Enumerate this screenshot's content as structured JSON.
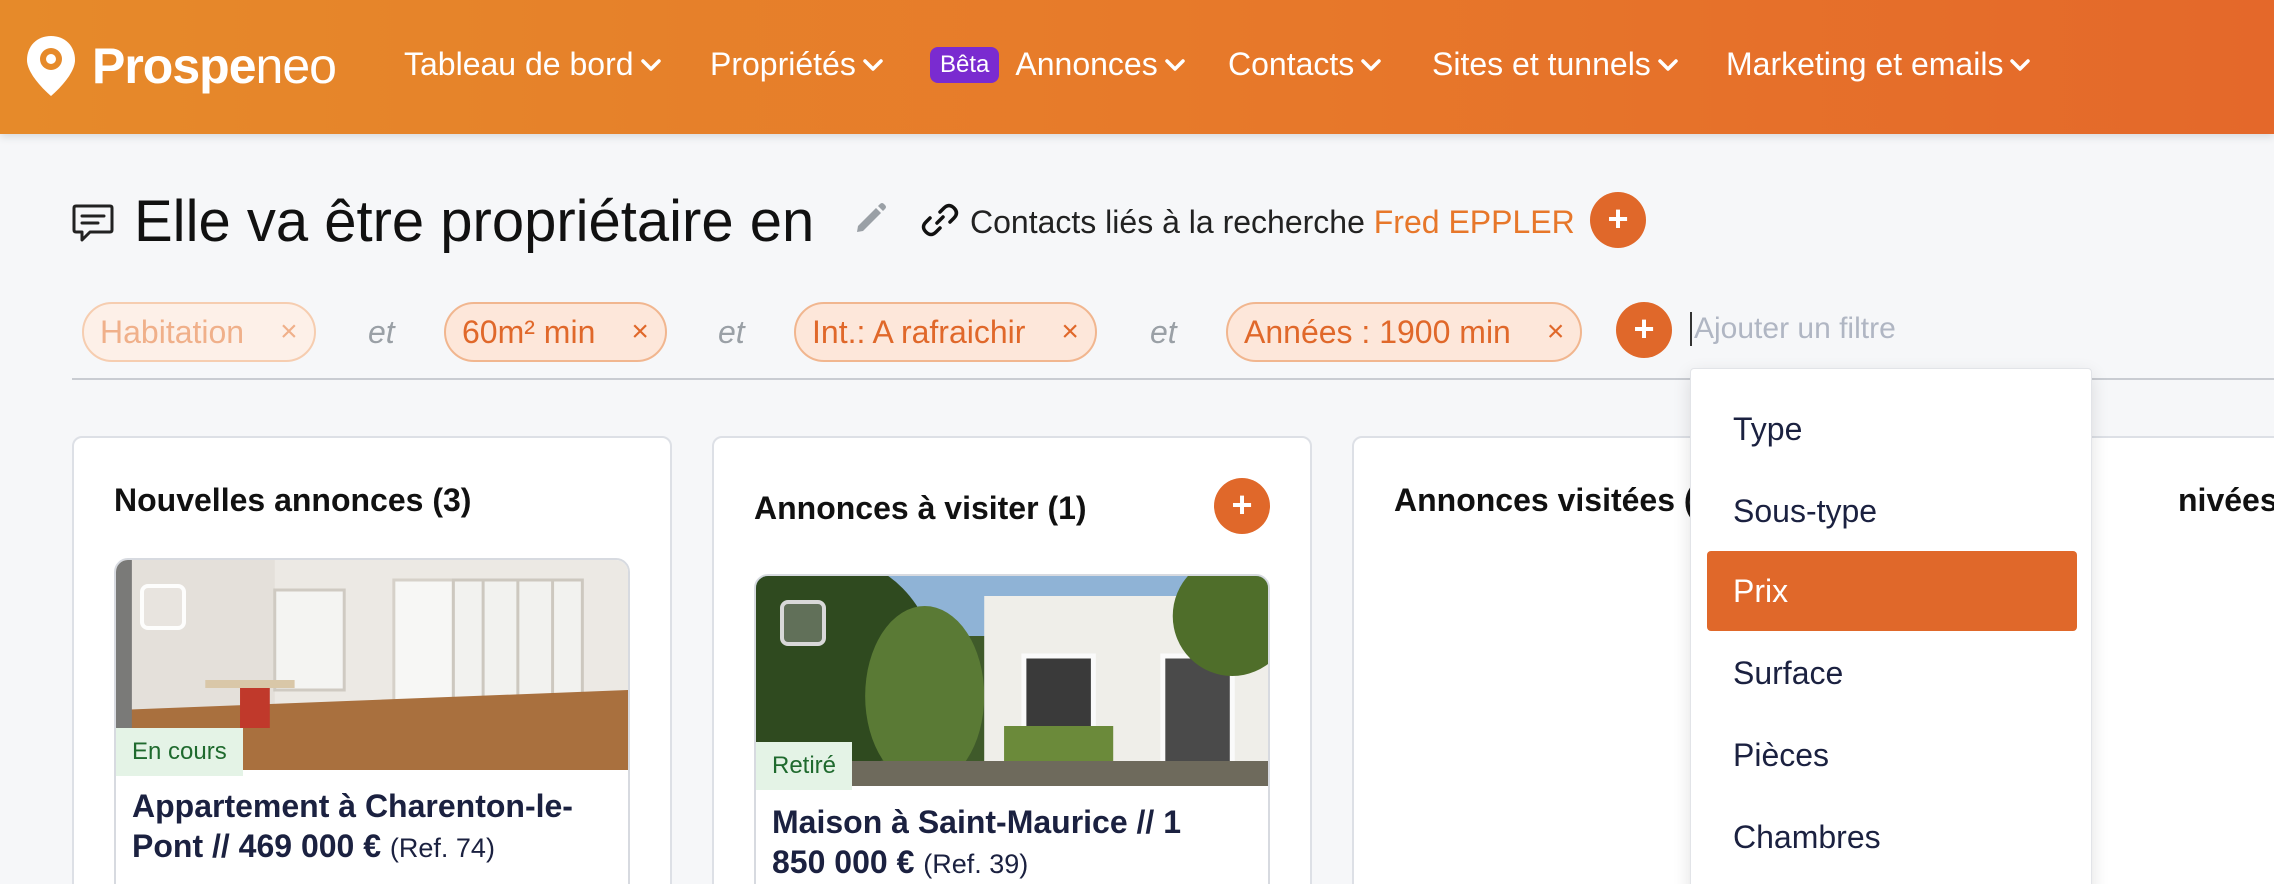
{
  "brand": {
    "name_bold": "Prospe",
    "name_thin": "neo"
  },
  "nav": [
    {
      "label": "Tableau de bord"
    },
    {
      "label": "Propriétés"
    },
    {
      "label": "Annonces",
      "badge": "Bêta"
    },
    {
      "label": "Contacts"
    },
    {
      "label": "Sites et tunnels"
    },
    {
      "label": "Marketing et emails"
    }
  ],
  "header": {
    "title": "Elle va être propriétaire en",
    "contacts_label": "Contacts liés à la recherche",
    "contact_name": "Fred EPPLER",
    "add_label": "+"
  },
  "filters": {
    "chips": [
      "Habitation",
      "60m² min",
      "Int.: A rafraichir",
      "Années : 1900 min"
    ],
    "connector": "et",
    "remove_label": "×",
    "add_label": "+",
    "placeholder": "Ajouter un filtre"
  },
  "columns": [
    {
      "title": "Nouvelles annonces (3)"
    },
    {
      "title": "Annonces à visiter (1)",
      "add_label": "+"
    },
    {
      "title": "Annonces visitées (",
      "title_right": "nivées, retiré"
    }
  ],
  "cards": [
    {
      "status": "En cours",
      "title_line1": "Appartement à Charenton-le-",
      "title_line2": "Pont // 469 000 €",
      "ref": "(Ref. 74)"
    },
    {
      "status": "Retiré",
      "title_line1": "Maison à Saint-Maurice // 1",
      "title_line2": "850 000 €",
      "ref": "(Ref. 39)"
    }
  ],
  "dropdown": {
    "options": [
      "Type",
      "Sous-type",
      "Prix",
      "Surface",
      "Pièces",
      "Chambres"
    ],
    "selected": "Prix"
  },
  "colors": {
    "accent": "#e0682a",
    "beta": "#7a2bd0",
    "status_bg": "#e4f3e6"
  }
}
